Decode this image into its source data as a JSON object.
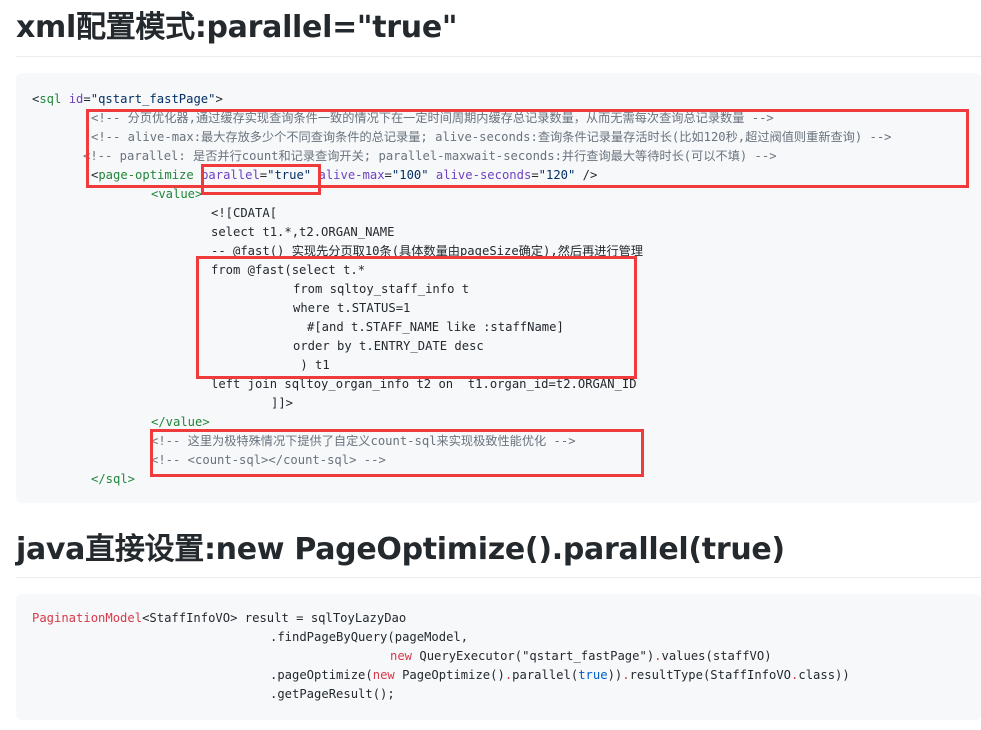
{
  "section1": {
    "heading_prefix": "xml",
    "heading_cjk": "配置模式",
    "heading_suffix": ":parallel=\"true\"",
    "code": {
      "l1_open": "<",
      "l1_tag": "sql",
      "l1_attr": "id",
      "l1_eq": "=",
      "l1_val": "\"qstart_fastPage\"",
      "l1_close": ">",
      "c1": "<!-- 分页优化器,通过缓存实现查询条件一致的情况下在一定时间周期内缓存总记录数量，从而无需每次查询总记录数量 -->",
      "c2": "<!-- alive-max:最大存放多少个不同查询条件的总记录量; alive-seconds:查询条件记录量存活时长(比如120秒,超过阀值则重新查询) -->",
      "c3": "<!-- parallel: 是否并行count和记录查询开关; parallel-maxwait-seconds:并行查询最大等待时长(可以不填) -->",
      "po_open": "<",
      "po_tag": "page-optimize",
      "po_a1": "parallel",
      "po_v1": "\"true\"",
      "po_a2": "alive-max",
      "po_v2": "\"100\"",
      "po_a3": "alive-seconds",
      "po_v3": "\"120\"",
      "po_close": " />",
      "value_open": "<value>",
      "cdata_open": "<![CDATA[",
      "sql1": "select t1.*,t2.ORGAN_NAME",
      "sql2": "-- @fast() 实现先分页取10条(具体数量由pageSize确定),然后再进行管理",
      "sql3": "from @fast(select t.*",
      "sql4": "from sqltoy_staff_info t",
      "sql5": "where t.STATUS=1",
      "sql6": "#[and t.STAFF_NAME like :staffName]",
      "sql7": "order by t.ENTRY_DATE desc",
      "sql8": " ) t1",
      "sql9": "left join sqltoy_organ_info t2 on  t1.organ_id=t2.ORGAN_ID",
      "cdata_close": "]]>",
      "value_close": "</value>",
      "c4": "<!-- 这里为极特殊情况下提供了自定义count-sql来实现极致性能优化 -->",
      "c5": "<!-- <count-sql></count-sql> -->",
      "sql_close": "</sql>"
    }
  },
  "section2": {
    "heading_prefix": "java",
    "heading_cjk": "直接设置",
    "heading_suffix": ":new PageOptimize().parallel(true)",
    "code": {
      "j1_type": "PaginationModel",
      "j1_generic": "<StaffInfoVO>",
      "j1_rest": " result = sqlToyLazyDao",
      "j2": ".findPageByQuery(pageModel,",
      "j3_new": "new",
      "j3_rest": " QueryExecutor(\"qstart_fastPage\")",
      "j3_dot": ".",
      "j3_tail": "values(staffVO)",
      "j4_a": ".pageOptimize(",
      "j4_new": "new",
      "j4_b": " PageOptimize()",
      "j4_dot1": ".",
      "j4_c": "parallel(",
      "j4_true": "true",
      "j4_d": "))",
      "j4_dot2": ".",
      "j4_e": "resultType(StaffInfoVO",
      "j4_dot3": ".",
      "j4_f": "class))",
      "j5": ".getPageResult();"
    }
  },
  "annotations": {
    "highlight_color": "#ef3b3b"
  }
}
